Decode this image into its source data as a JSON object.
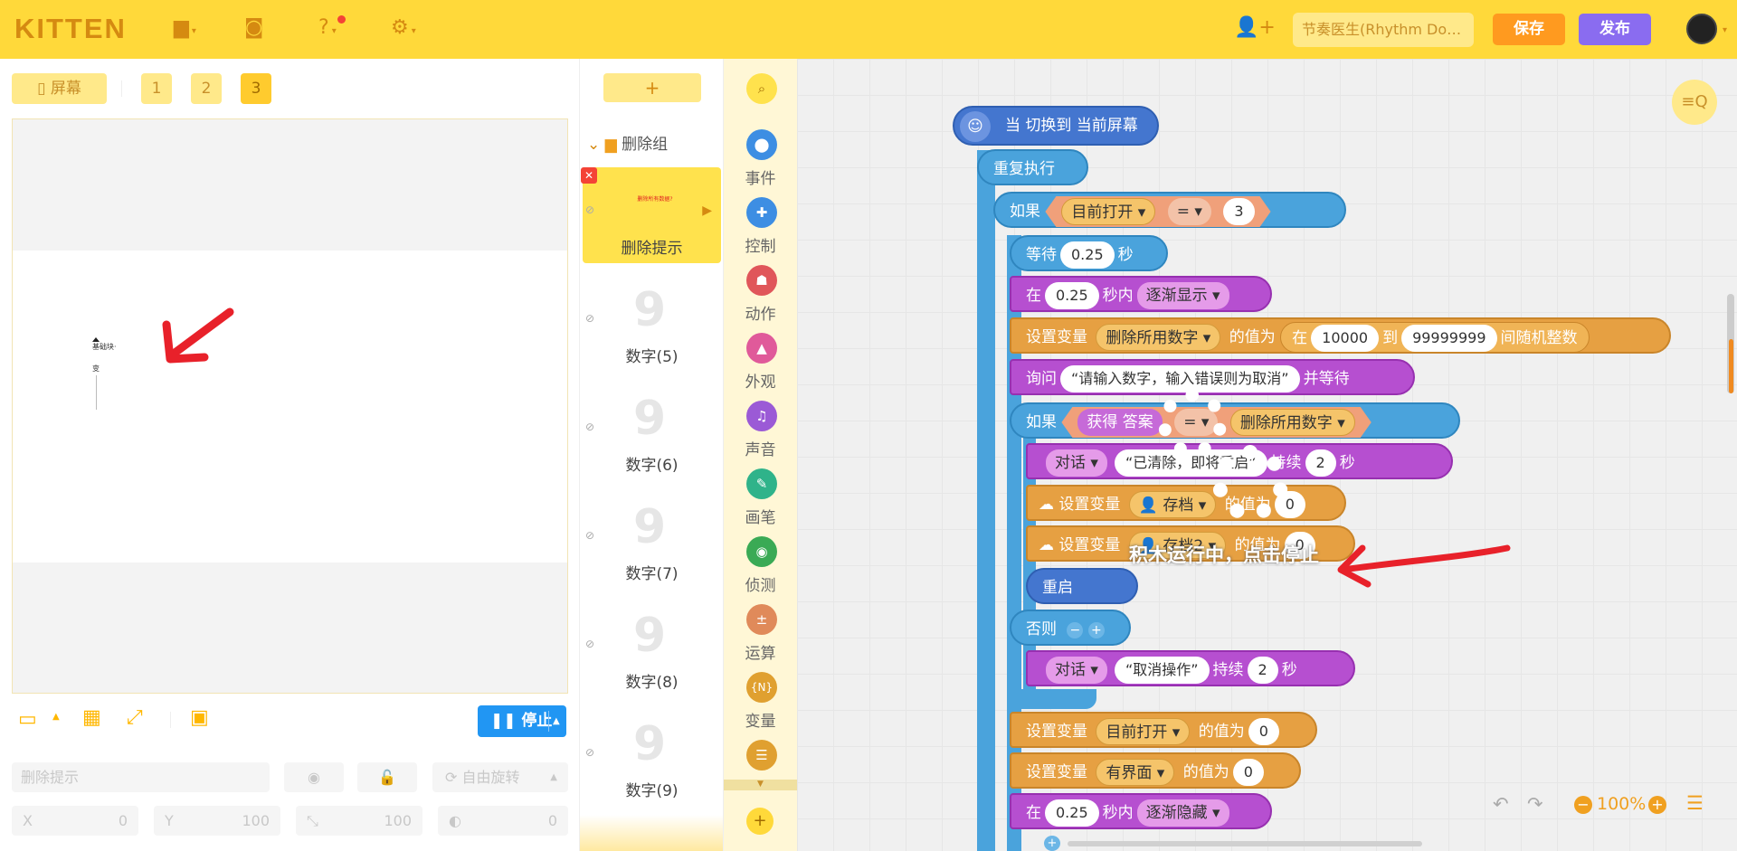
{
  "app": {
    "logo": "KITTEN"
  },
  "header": {
    "project_name": "节奏医生(Rhythm Do…",
    "save_label": "保存",
    "publish_label": "发布"
  },
  "stage": {
    "screen_label": "屏幕",
    "pages": [
      "1",
      "2",
      "3"
    ],
    "active_page": "3",
    "preview_text1": "基础块·",
    "preview_text2": "变",
    "stop_label": "停止"
  },
  "props": {
    "name_placeholder": "删除提示",
    "rotate_label": "自由旋转",
    "x_label": "X",
    "x_value": "0",
    "y_label": "Y",
    "y_value": "100",
    "size_value": "100",
    "angle_value": "0"
  },
  "sprites": {
    "add_label": "+",
    "group_name": "删除组",
    "items": [
      {
        "name": "删除提示"
      },
      {
        "name": "数字(5)"
      },
      {
        "name": "数字(6)"
      },
      {
        "name": "数字(7)"
      },
      {
        "name": "数字(8)"
      },
      {
        "name": "数字(9)"
      }
    ],
    "selected_thumb_text": "删除所有数据?"
  },
  "palette": {
    "categories": [
      {
        "label": "事件",
        "color": "#3d8ee3"
      },
      {
        "label": "控制",
        "color": "#3d8ee3"
      },
      {
        "label": "动作",
        "color": "#e0565a"
      },
      {
        "label": "外观",
        "color": "#e05a9a"
      },
      {
        "label": "声音",
        "color": "#9b5ad6"
      },
      {
        "label": "画笔",
        "color": "#2fb38a"
      },
      {
        "label": "侦测",
        "color": "#3aaa55"
      },
      {
        "label": "运算",
        "color": "#e08a5a"
      },
      {
        "label": "变量",
        "color": "#e0a030"
      },
      {
        "label": "列表",
        "color": "#e0a030"
      }
    ]
  },
  "blocks": {
    "hat": "当 切换到 当前屏幕",
    "repeat": "重复执行",
    "if1": {
      "kw": "如果",
      "var": "目前打开",
      "op": "=",
      "val": "3"
    },
    "wait": {
      "kw": "等待",
      "val": "0.25",
      "unit": "秒"
    },
    "fadein": {
      "kw": "在",
      "val": "0.25",
      "mid": "秒内",
      "sel": "逐渐显示"
    },
    "setrand": {
      "kw": "设置变量",
      "var": "删除所用数字",
      "mid": "的值为",
      "in": "在",
      "lo": "10000",
      "to": "到",
      "hi": "99999999",
      "tail": "间随机整数"
    },
    "ask": {
      "kw": "询问",
      "text": "“请输入数字，输入错误则为取消”",
      "tail": "并等待"
    },
    "if2": {
      "kw": "如果",
      "left": "获得 答案",
      "op": "=",
      "right": "删除所用数字"
    },
    "say1": {
      "kw": "对话",
      "text": "“已清除，即将重启”",
      "mid": "持续",
      "val": "2",
      "unit": "秒"
    },
    "set1": {
      "kw": "设置变量",
      "var": "存档",
      "mid": "的值为",
      "val": "0"
    },
    "set2": {
      "kw": "设置变量",
      "var": "存档2",
      "mid": "的值为",
      "val": "0"
    },
    "restart": "重启",
    "else": "否则",
    "say2": {
      "kw": "对话",
      "text": "“取消操作”",
      "mid": "持续",
      "val": "2",
      "unit": "秒"
    },
    "set3": {
      "kw": "设置变量",
      "var": "目前打开",
      "mid": "的值为",
      "val": "0"
    },
    "set4": {
      "kw": "设置变量",
      "var": "有界面",
      "mid": "的值为",
      "val": "0"
    },
    "fadeout": {
      "kw": "在",
      "val": "0.25",
      "mid": "秒内",
      "sel": "逐渐隐藏"
    }
  },
  "overlay": {
    "hint": "积木运行中，点击停止"
  },
  "workspace": {
    "zoom": "100%"
  }
}
